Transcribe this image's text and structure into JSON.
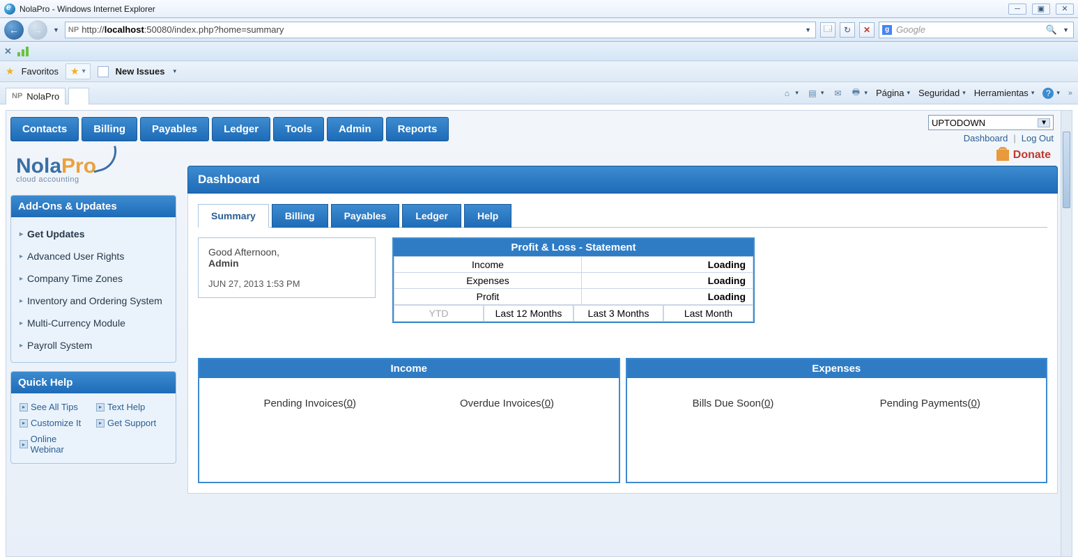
{
  "window": {
    "title": "NolaPro - Windows Internet Explorer"
  },
  "address": {
    "prefix": "NP",
    "scheme": "http://",
    "host": "localhost",
    "port": ":50080",
    "path": "/index.php?home=summary"
  },
  "search": {
    "placeholder": "Google"
  },
  "favorites": {
    "label": "Favoritos",
    "new_issues": "New Issues"
  },
  "tab": {
    "title": "NolaPro"
  },
  "cmd": {
    "pagina": "Página",
    "seguridad": "Seguridad",
    "herramientas": "Herramientas"
  },
  "menu": {
    "contacts": "Contacts",
    "billing": "Billing",
    "payables": "Payables",
    "ledger": "Ledger",
    "tools": "Tools",
    "admin": "Admin",
    "reports": "Reports"
  },
  "company_select": "UPTODOWN",
  "quicklinks": {
    "dashboard": "Dashboard",
    "logout": "Log Out"
  },
  "logo": {
    "sub": "cloud accounting"
  },
  "donate": "Donate",
  "page_title": "Dashboard",
  "subtabs": {
    "summary": "Summary",
    "billing": "Billing",
    "payables": "Payables",
    "ledger": "Ledger",
    "help": "Help"
  },
  "addons": {
    "header": "Add-Ons & Updates",
    "items": [
      "Get Updates",
      "Advanced User Rights",
      "Company Time Zones",
      "Inventory and Ordering System",
      "Multi-Currency Module",
      "Payroll System"
    ]
  },
  "quickhelp": {
    "header": "Quick Help",
    "see_tips": "See All Tips",
    "text_help": "Text Help",
    "customize": "Customize It",
    "support": "Get Support",
    "webinar": "Online Webinar"
  },
  "greeting": {
    "line1": "Good Afternoon,",
    "user": "Admin",
    "timestamp": "JUN 27, 2013 1:53 PM"
  },
  "pl": {
    "title": "Profit & Loss - Statement",
    "rows": [
      {
        "label": "Income",
        "value": "Loading"
      },
      {
        "label": "Expenses",
        "value": "Loading"
      },
      {
        "label": "Profit",
        "value": "Loading"
      }
    ],
    "buttons": {
      "ytd": "YTD",
      "m12": "Last 12 Months",
      "m3": "Last 3 Months",
      "m1": "Last Month"
    }
  },
  "income": {
    "title": "Income",
    "pending_label": "Pending Invoices(",
    "pending_count": "0",
    "overdue_label": "Overdue Invoices(",
    "overdue_count": "0"
  },
  "expenses": {
    "title": "Expenses",
    "due_label": "Bills Due Soon(",
    "due_count": "0",
    "pending_label": "Pending Payments(",
    "pending_count": "0"
  }
}
